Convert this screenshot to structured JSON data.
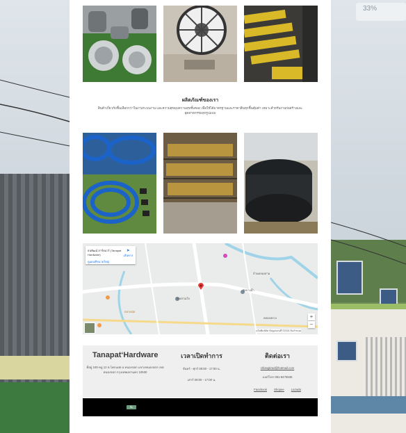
{
  "overlay": {
    "percent": "33%"
  },
  "products": {
    "title": "ผลิตภัณฑ์ของเรา",
    "description": "สินค้าเกี่ยวกับชิ้นเลือกกว่าในงานระบบงาน และความสุขมุมความสุขชั้นของ เพื่อให้ได้มาตรฐานและราคาสินทุกชิ้นคุ้มค่า เหมาะสำหรับงานก่อสร้างและอุตสาหกรรมทุกรูปแบบ"
  },
  "map": {
    "place_name": "ธนพัฒน์ ฮาร์ดแวร์ (Tanapat Hardware)",
    "view_larger": "ดูแผนที่ขนาดใหญ่",
    "directions": "เส้นทาง",
    "zoom_in": "+",
    "zoom_out": "−",
    "labels": [
      "บ้านคลองสาม",
      "ซอยร่วมใจ",
      "ตลาดนัด",
      "วัดบางน้ำ",
      "คลองหลวง"
    ],
    "footer_text": "แป้นพิมพ์ลัด   ข้อมูลแผนที่ ©2024   ข้อกำหนด"
  },
  "footer": {
    "brand": "Tanapat‘Hardware",
    "address": "ที่อยู่ 249 หมู่ 12 ต.โคกแฝด อ.หนองจอก แขวงหนองจอก เขตหนองจอก กรุงเทพมหานคร 10530",
    "hours_title": "เวลาเปิดทำการ",
    "hours_weekday": "จันทร์ - ศุกร์ 08:00 - 17:00 น.",
    "hours_weekend": "เสาร์ 08:00 - 17:00 น.",
    "contact_title": "ติดต่อเรา",
    "email": "chlangkrad@hotmail.com",
    "phone": "เบอร์โทร 081-8475535",
    "links": [
      "Facebook",
      "Shopee",
      "Lazada"
    ],
    "top_button": "ขึ้น"
  },
  "colors": {
    "accent": "#6b9e7e",
    "footer_bg": "#efefef",
    "bar": "#000000"
  }
}
